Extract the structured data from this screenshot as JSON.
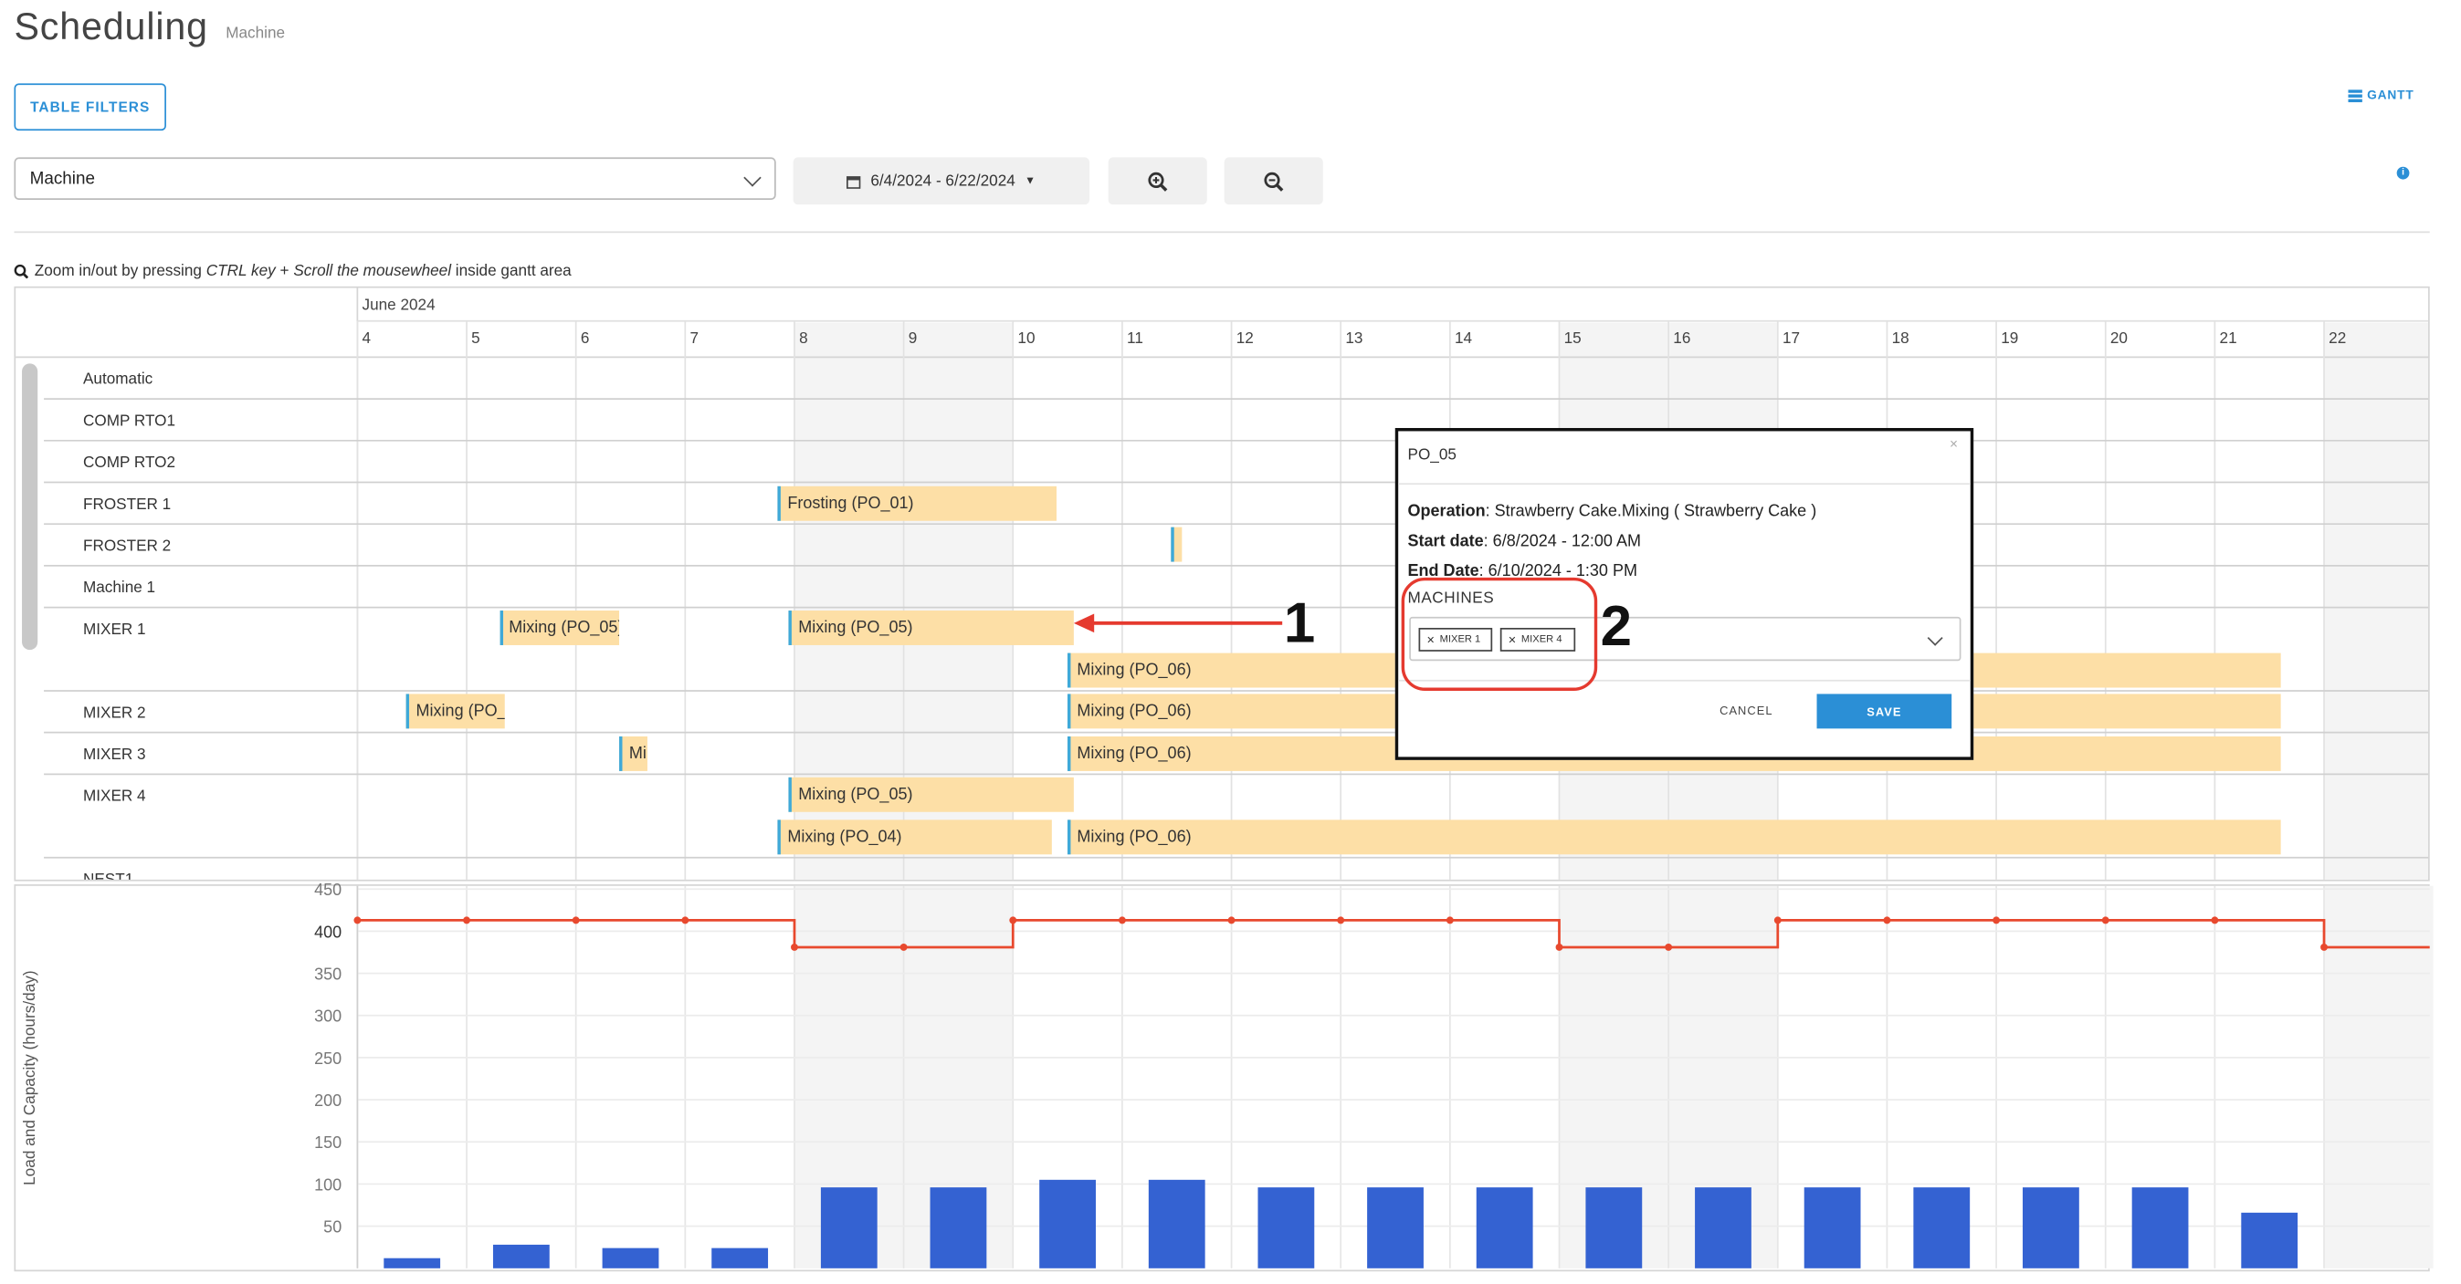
{
  "header": {
    "title": "Scheduling",
    "subtitle": "Machine",
    "table_filters_label": "TABLE FILTERS",
    "gantt_label": "GANTT",
    "info_icon": "info-icon"
  },
  "toolbar": {
    "resource_select": {
      "value": "Machine"
    },
    "date_range": "6/4/2024 - 6/22/2024",
    "zoom_in_icon": "zoom-in-icon",
    "zoom_out_icon": "zoom-out-icon"
  },
  "hint": {
    "text_1": "Zoom in/out by pressing ",
    "ctrl_key": "CTRL key",
    "plus": " + ",
    "scroll": "Scroll the mousewheel",
    "text_2": " inside gantt area"
  },
  "timeline": {
    "month": "June 2024",
    "days": [
      "4",
      "5",
      "6",
      "7",
      "8",
      "9",
      "10",
      "11",
      "12",
      "13",
      "14",
      "15",
      "16",
      "17",
      "18",
      "19",
      "20",
      "21",
      "22"
    ],
    "shaded_days": [
      "8",
      "9",
      "15",
      "16",
      "22"
    ]
  },
  "resources": [
    {
      "name": "Automatic",
      "tasks": []
    },
    {
      "name": "COMP RTO1",
      "tasks": []
    },
    {
      "name": "COMP RTO2",
      "tasks": []
    },
    {
      "name": "FROSTER 1",
      "tasks": [
        {
          "label": "Frosting (PO_01)",
          "start_day": 7.85,
          "end_day": 10.4
        }
      ]
    },
    {
      "name": "FROSTER 2",
      "tasks": [
        {
          "label": "",
          "start_day": 11.45,
          "end_day": 11.55
        }
      ]
    },
    {
      "name": "Machine 1",
      "tasks": []
    },
    {
      "name": "MIXER 1",
      "tasks": [
        {
          "label": "Mixing (PO_05)",
          "start_day": 5.3,
          "end_day": 6.4,
          "lane": 0
        },
        {
          "label": "Mixing (PO_05)",
          "start_day": 7.95,
          "end_day": 10.55,
          "lane": 0
        },
        {
          "label": "Mixing (PO_06)",
          "start_day": 10.5,
          "end_day": 21.6,
          "lane": 1
        }
      ]
    },
    {
      "name": "MIXER 2",
      "tasks": [
        {
          "label": "Mixing (PO_",
          "start_day": 4.45,
          "end_day": 5.35
        },
        {
          "label": "Mixing (PO_06)",
          "start_day": 10.5,
          "end_day": 21.6
        }
      ]
    },
    {
      "name": "MIXER 3",
      "tasks": [
        {
          "label": "Mi",
          "start_day": 6.4,
          "end_day": 6.65
        },
        {
          "label": "Mixing (PO_06)",
          "start_day": 10.5,
          "end_day": 21.6
        }
      ]
    },
    {
      "name": "MIXER 4",
      "tasks": [
        {
          "label": "Mixing (PO_05)",
          "start_day": 7.95,
          "end_day": 10.55,
          "lane": 0
        },
        {
          "label": "Mixing (PO_04)",
          "start_day": 7.85,
          "end_day": 10.35,
          "lane": 1
        },
        {
          "label": "Mixing (PO_06)",
          "start_day": 10.5,
          "end_day": 21.6,
          "lane": 1
        }
      ]
    },
    {
      "name": "NEST1",
      "tasks": []
    }
  ],
  "popup": {
    "title": "PO_05",
    "operation_label": "Operation",
    "operation_value": ": Strawberry Cake.Mixing ( Strawberry Cake )",
    "start_label": "Start date",
    "start_value": ": 6/8/2024 - 12:00 AM",
    "end_label": "End Date",
    "end_value": ": 6/10/2024 - 1:30 PM",
    "machines_label": "MACHINES",
    "chips": [
      "MIXER 1",
      "MIXER 4"
    ],
    "cancel_label": "CANCEL",
    "save_label": "SAVE"
  },
  "callouts": {
    "one": "1",
    "two": "2"
  },
  "chart_data": {
    "type": "bar",
    "ylabel": "Load and Capacity (hours/day)",
    "ylim": [
      0,
      450
    ],
    "yticks": [
      50,
      100,
      150,
      200,
      250,
      300,
      350,
      400,
      450
    ],
    "categories": [
      "4",
      "5",
      "6",
      "7",
      "8",
      "9",
      "10",
      "11",
      "12",
      "13",
      "14",
      "15",
      "16",
      "17",
      "18",
      "19",
      "20",
      "21",
      "22"
    ],
    "series": [
      {
        "kind": "bar",
        "color": "#3462d2",
        "values": [
          12,
          28,
          24,
          24,
          96,
          96,
          105,
          105,
          96,
          96,
          96,
          96,
          96,
          96,
          96,
          96,
          96,
          66,
          null
        ]
      },
      {
        "kind": "step-line",
        "color": "#e8492e",
        "values": [
          413,
          413,
          413,
          413,
          381,
          381,
          413,
          413,
          413,
          413,
          413,
          381,
          381,
          413,
          413,
          413,
          413,
          413,
          381
        ]
      }
    ]
  }
}
